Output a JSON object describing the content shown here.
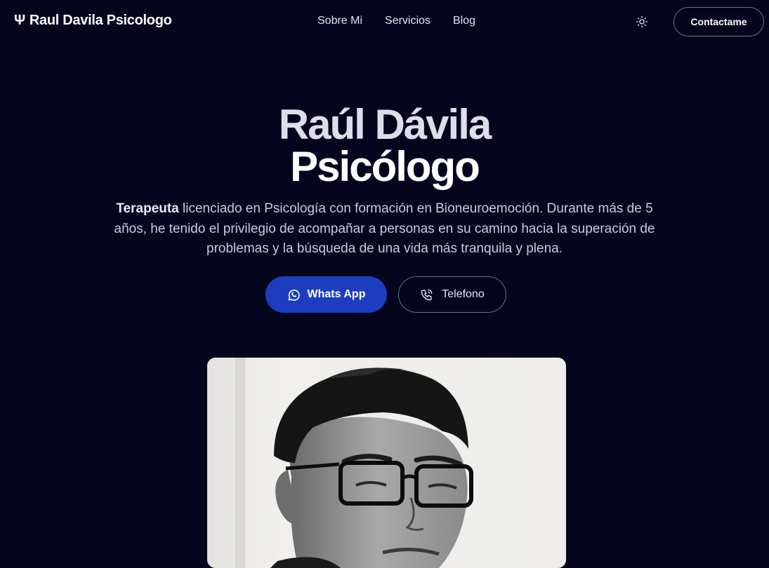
{
  "header": {
    "brand_icon": "Ψ",
    "brand_name": "Raul Davila Psicologo",
    "menu": [
      {
        "label": "Sobre Mi"
      },
      {
        "label": "Servicios"
      },
      {
        "label": "Blog"
      }
    ],
    "theme_icon": "sun-icon",
    "contact_label": "Contactame"
  },
  "hero": {
    "title_line1": "Raúl Dávila",
    "title_line2": "Psicólogo",
    "desc_bold": "Terapeuta",
    "desc_rest": " licenciado en Psicología con formación en Bioneuroemoción. Durante más de 5 años, he tenido el privilegio de acompañar a personas en su camino hacia la superación de problemas y la búsqueda de una vida más tranquila y plena.",
    "whatsapp_label": "Whats App",
    "phone_label": "Telefono"
  },
  "colors": {
    "background": "#05061d",
    "accent": "#1d3dc0",
    "border": "#6c6f86"
  },
  "icons": {
    "whatsapp": "whatsapp-icon",
    "phone": "phone-icon"
  }
}
